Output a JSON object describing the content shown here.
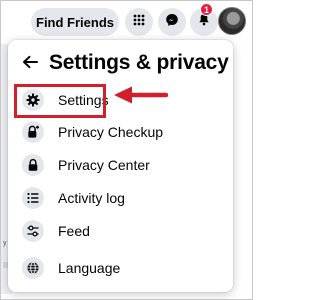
{
  "topbar": {
    "find_friends_label": "Find Friends",
    "notification_count": "1",
    "icons": [
      "menu-grid-icon",
      "messenger-icon",
      "bell-icon"
    ]
  },
  "panel": {
    "title": "Settings & privacy",
    "items": [
      {
        "label": "Settings",
        "icon": "gear-icon"
      },
      {
        "label": "Privacy Checkup",
        "icon": "lock-plus-icon"
      },
      {
        "label": "Privacy Center",
        "icon": "lock-icon"
      },
      {
        "label": "Activity log",
        "icon": "list-icon"
      },
      {
        "label": "Feed",
        "icon": "sliders-icon"
      },
      {
        "label": "Language",
        "icon": "globe-icon"
      }
    ]
  },
  "background": {
    "fragment_1": "y"
  },
  "colors": {
    "annotation_red": "#d11f2b",
    "badge_red": "#e41e3f",
    "button_gray": "#e4e6eb"
  }
}
